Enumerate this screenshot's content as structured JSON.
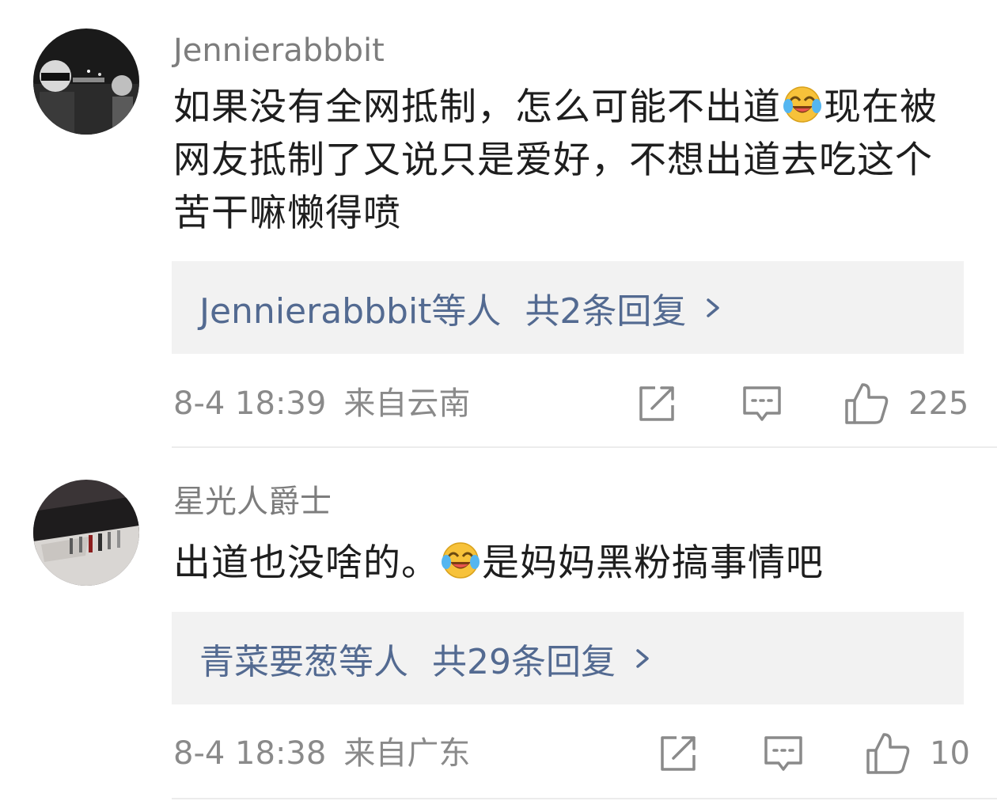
{
  "comments": [
    {
      "username": "Jennierabbbit",
      "avatar_icon": "user-avatar-dark-photo",
      "body_lines": [
        "如果没有全网抵制，怎么可能不出道",
        "现在被网友抵制了又说只是爱好，不想出道去吃这个苦干嘛懒得喷"
      ],
      "body_part1": "如果没有全网抵制，怎么可能不出道",
      "body_part2": "现在被网友抵制了又说只是爱好，不想出道去吃这个苦干嘛懒得喷",
      "emoji_icon": "laugh-cry-emoji",
      "reply_names": "Jennierabbbit等人",
      "reply_count": "共2条回复",
      "date": "8-4 18:39",
      "location": "来自云南",
      "likes": "225"
    },
    {
      "username": "星光人爵士",
      "avatar_icon": "user-avatar-figures-photo",
      "body_part1": "出道也没啥的。",
      "body_part2": "是妈妈黑粉搞事情吧",
      "emoji_icon": "laugh-cry-emoji",
      "reply_names": "青菜要葱等人",
      "reply_count": "共29条回复",
      "date": "8-4 18:38",
      "location": "来自广东",
      "likes": "10"
    }
  ],
  "colors": {
    "username": "#7d7d7d",
    "body": "#1e1e1e",
    "link": "#536a91",
    "meta": "#8a8a8a",
    "reply_bg": "#f2f2f2"
  }
}
